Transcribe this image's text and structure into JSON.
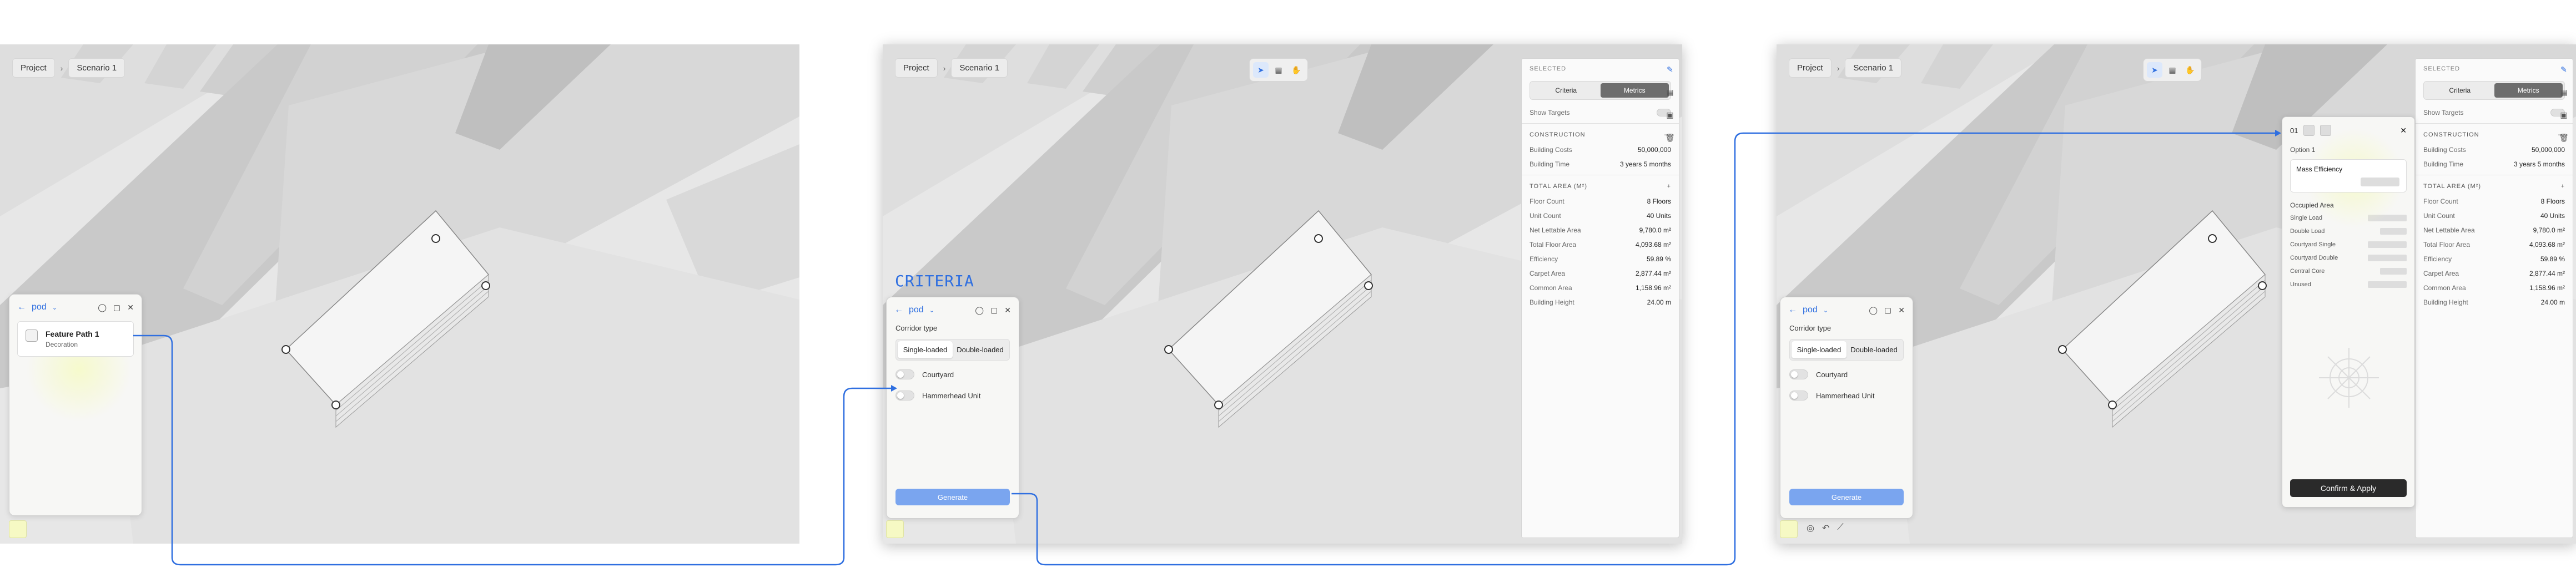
{
  "breadcrumb": {
    "project": "Project",
    "separator": "›",
    "scenario": "Scenario 1"
  },
  "toolbar": {
    "tools": [
      "select-icon",
      "building-icon",
      "hand-icon"
    ]
  },
  "panel_a": {
    "back": "←",
    "project_name": "pod",
    "chevron": "⌄",
    "icons": [
      "comment-icon",
      "chat-icon",
      "close-icon"
    ],
    "feature": {
      "title": "Feature Path 1",
      "subtitle": "Decoration"
    }
  },
  "criteria": {
    "heading": "CRITERIA",
    "back": "←",
    "project_name": "pod",
    "chevron": "⌄",
    "corridor_label": "Corridor type",
    "corridor_options": [
      "Single-loaded",
      "Double-loaded"
    ],
    "toggles": [
      "Courtyard",
      "Hammerhead Unit"
    ],
    "generate": "Generate"
  },
  "sidebar": {
    "selected": "SELECTED",
    "tabs": [
      "Criteria",
      "Metrics"
    ],
    "show_targets": "Show Targets",
    "construction": "CONSTRUCTION",
    "construction_rows": [
      {
        "k": "Building Costs",
        "v": "50,000,000"
      },
      {
        "k": "Building Time",
        "v": "3 years 5 months"
      }
    ],
    "total_area": "TOTAL AREA (M²)",
    "area_rows": [
      {
        "k": "Floor Count",
        "v": "8 Floors"
      },
      {
        "k": "Unit Count",
        "v": "40 Units"
      },
      {
        "k": "Net Lettable Area",
        "v": "9,780.0 m²"
      },
      {
        "k": "Total Floor Area",
        "v": "4,093.68 m²"
      },
      {
        "k": "Efficiency",
        "v": "59.89 %"
      },
      {
        "k": "Carpet Area",
        "v": "2,877.44 m²"
      },
      {
        "k": "Common Area",
        "v": "1,158.96 m²"
      },
      {
        "k": "Building Height",
        "v": "24.00 m"
      }
    ]
  },
  "option_panel": {
    "index": "01",
    "option": "Option 1",
    "card_label": "Mass Efficiency",
    "section": "Occupied Area",
    "rows": [
      "Single Load",
      "Double Load",
      "Courtyard Single",
      "Courtyard Double",
      "Central Core",
      "Unused"
    ],
    "confirm": "Confirm & Apply"
  },
  "colors": {
    "accent": "#2f6fe0",
    "button": "#7aa5ef",
    "confirm": "#2a2a2a"
  }
}
